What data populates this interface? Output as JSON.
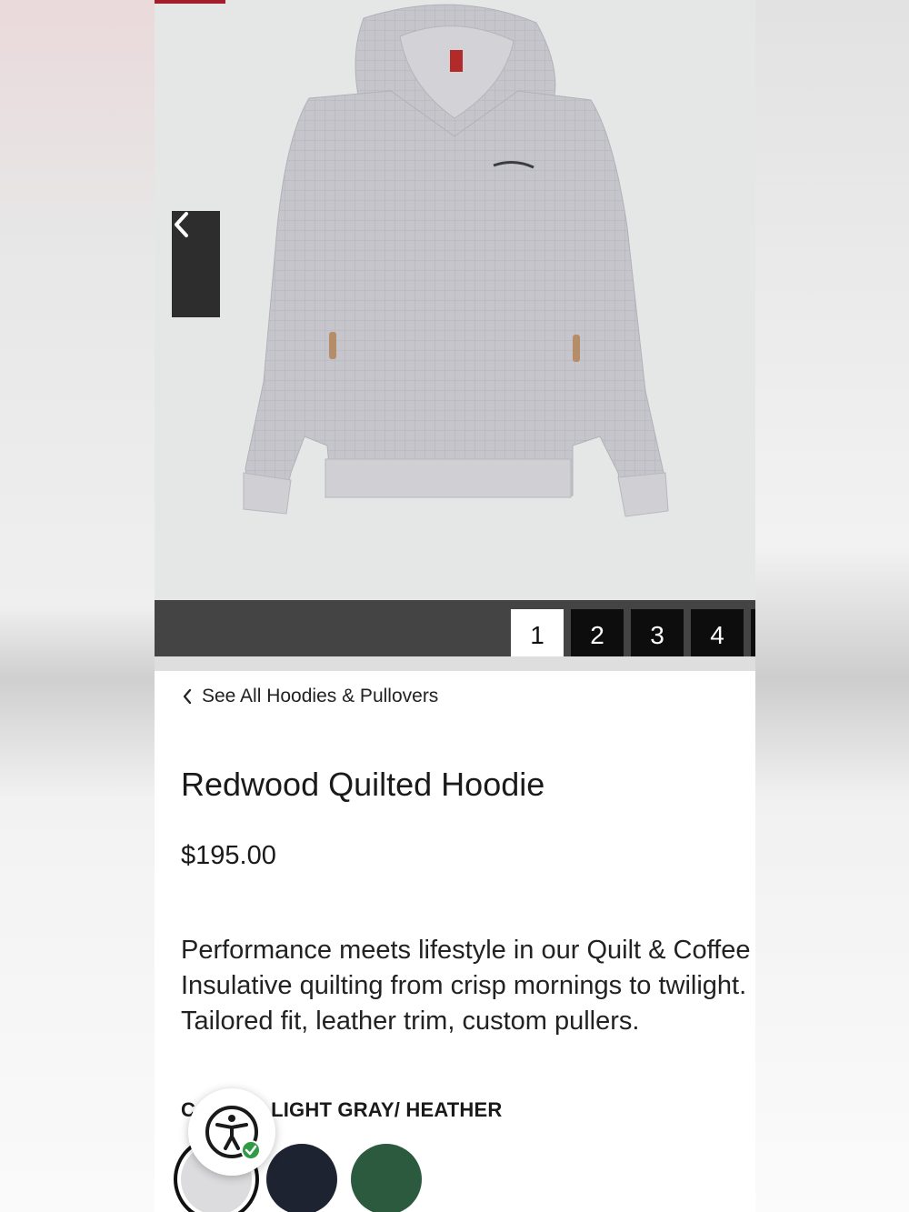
{
  "product": {
    "breadcrumb_label": "See All Hoodies & Pullovers",
    "title": "Redwood Quilted Hoodie",
    "price": "$195.00",
    "description_lines": [
      "Performance meets lifestyle in our Quilt & Coffee",
      "Insulative quilting from crisp mornings to twilight.",
      "Tailored fit, leather trim, custom pullers."
    ],
    "color_label_prefix": "C",
    "color_label_value": "LIGHT GRAY/ HEATHER"
  },
  "gallery": {
    "pages": [
      "1",
      "2",
      "3",
      "4"
    ],
    "active_page": "1",
    "prev_icon": "chevron-left-icon"
  },
  "swatches": [
    {
      "name": "light-gray-heather",
      "color": "#dcdcdf",
      "selected": true
    },
    {
      "name": "navy",
      "color": "#1d2330",
      "selected": false
    },
    {
      "name": "forest-green",
      "color": "#2c5a3f",
      "selected": false
    }
  ],
  "colors": {
    "accent": "#a21e2a",
    "pager_bg": "#444444",
    "success": "#2e9b45"
  },
  "accessibility": {
    "icon": "accessibility-person-icon",
    "status_icon": "checkmark-badge-icon"
  }
}
